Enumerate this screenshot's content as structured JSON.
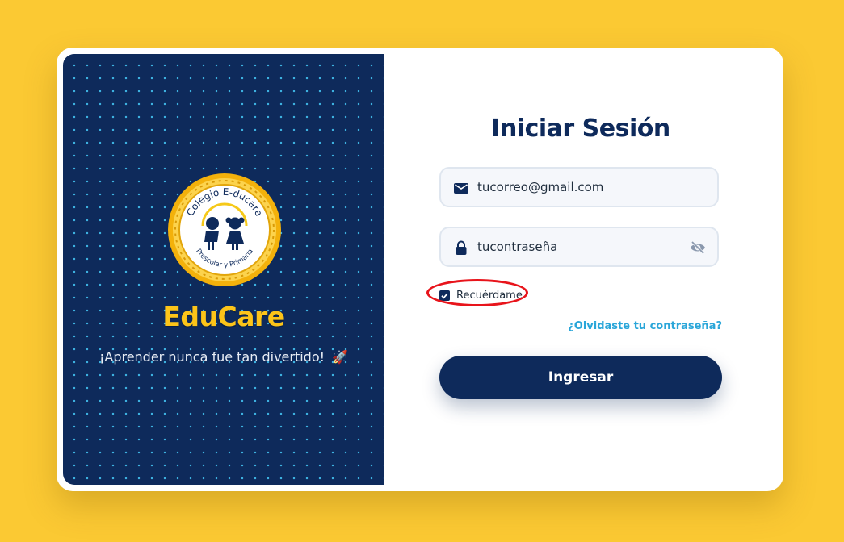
{
  "brand": {
    "name": "EduCare",
    "tagline": "¡Aprender nunca fue tan divertido!",
    "tagline_emoji": "🚀",
    "logo": {
      "top_text": "Colegio E-ducare",
      "bottom_text": "Prescolar y Primaria"
    }
  },
  "login": {
    "title": "Iniciar Sesión",
    "email": {
      "value": "tucorreo@gmail.com",
      "icon": "mail-icon"
    },
    "password": {
      "value": "tucontraseña",
      "icon": "lock-icon",
      "toggle_icon": "eye-off-icon"
    },
    "remember": {
      "label": "Recuérdame",
      "checked": true
    },
    "forgot_link": "¿Olvidaste tu contraseña?",
    "submit_label": "Ingresar"
  },
  "colors": {
    "background": "#fbc933",
    "navy": "#0e2a5b",
    "accent_yellow": "#fcc419",
    "link_blue": "#2aa6d9",
    "highlight_red": "#e8141b"
  }
}
